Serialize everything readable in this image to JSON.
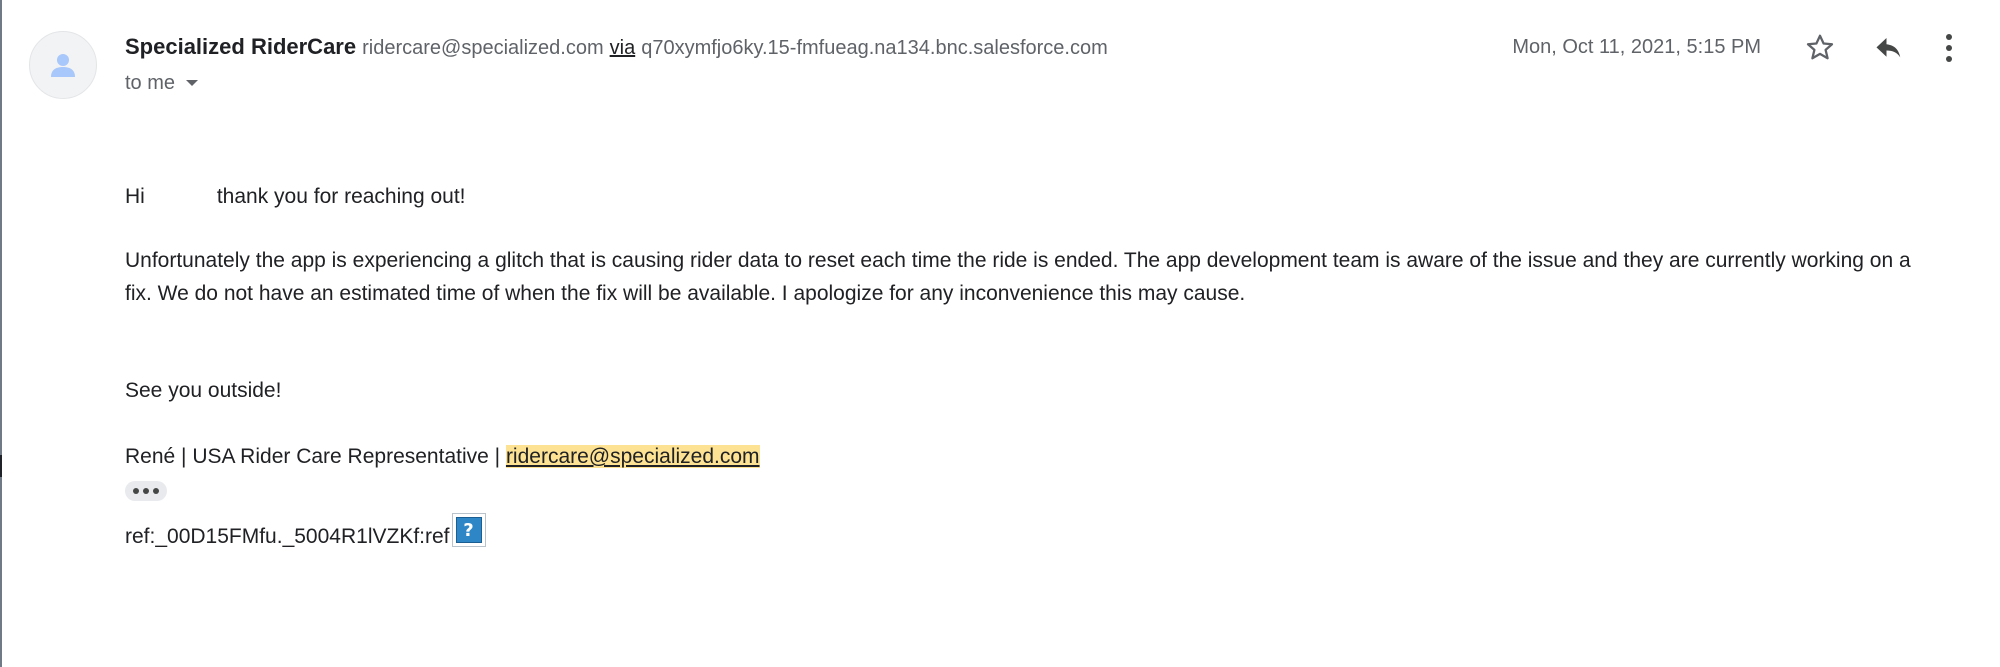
{
  "sender": {
    "name": "Specialized RiderCare",
    "email": "ridercare@specialized.com",
    "via_label": "via",
    "via_host": "q70xymfjo6ky.15-fmfueag.na134.bnc.salesforce.com"
  },
  "recipient": {
    "label": "to me"
  },
  "date": "Mon, Oct 11, 2021, 5:15 PM",
  "actions": {
    "star_icon": "star-outline",
    "reply_icon": "reply-arrow",
    "more_icon": "vertical-dots"
  },
  "body": {
    "greeting_prefix": "Hi",
    "greeting_rest": "thank you for reaching out!",
    "paragraph": "Unfortunately the app is experiencing a glitch that is causing rider data to reset each time the ride is ended. The app development team is aware of the issue and they are currently working on a fix. We do not have an estimated time of when the fix will be available. I apologize for any inconvenience this may cause.",
    "signoff": "See you outside!",
    "signature_prefix": "René | USA Rider Care Representative |",
    "signature_email": "ridercare@specialized.com",
    "ref": "ref:_00D15FMfu._5004R1lVZKf:ref",
    "missing_image_glyph": "?"
  },
  "colors": {
    "primary_text": "#202124",
    "secondary_text": "#5f6368",
    "highlight": "#fde293",
    "avatar_bg": "#f1f3f4",
    "avatar_glyph": "#a8c7fa"
  }
}
